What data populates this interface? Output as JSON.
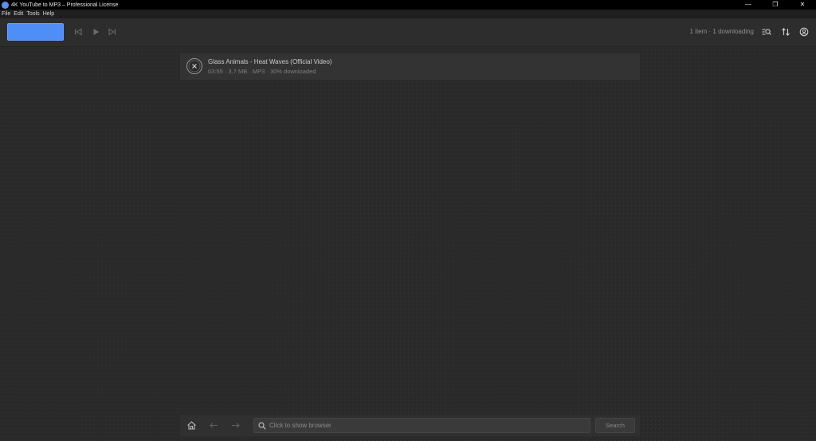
{
  "window": {
    "title": "4K YouTube to MP3 – Professional License",
    "controls": {
      "minimize": "—",
      "restore": "❐",
      "close": "✕"
    }
  },
  "menu": [
    "File",
    "Edit",
    "Tools",
    "Help"
  ],
  "toolbar": {
    "paste_button_color": "#4f8ef7",
    "icons": [
      "skip-back-icon",
      "play-icon",
      "skip-forward-icon",
      "search-list-icon",
      "sort-icon",
      "account-icon"
    ],
    "status": "1 item · 1 downloading"
  },
  "downloads": [
    {
      "title": "Glass Animals - Heat Waves (Official Video)",
      "meta": "03:55 · 3.7 MB · MP3 · 30% downloaded",
      "progress_percent": 30
    }
  ],
  "browser": {
    "search_placeholder": "Click to show browser",
    "search_button": "Search"
  },
  "colors": {
    "background": "#2a2a2a",
    "accent": "#4f8ef7"
  }
}
